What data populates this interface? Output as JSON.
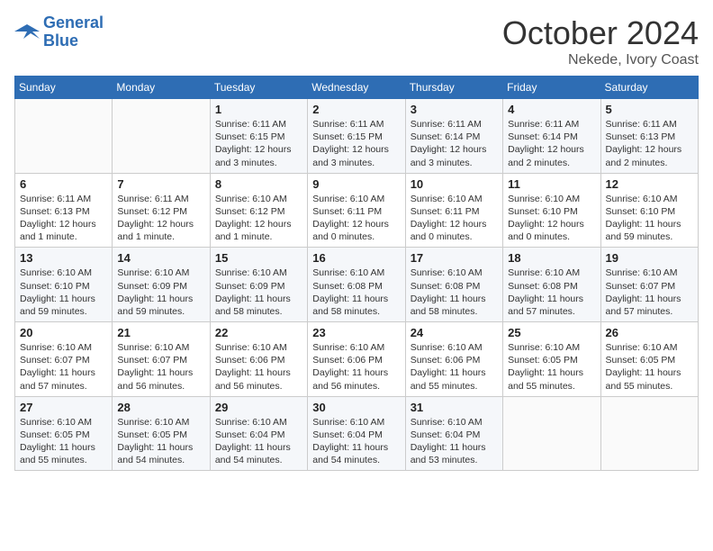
{
  "header": {
    "logo_line1": "General",
    "logo_line2": "Blue",
    "month": "October 2024",
    "location": "Nekede, Ivory Coast"
  },
  "weekdays": [
    "Sunday",
    "Monday",
    "Tuesday",
    "Wednesday",
    "Thursday",
    "Friday",
    "Saturday"
  ],
  "weeks": [
    [
      {
        "day": "",
        "info": ""
      },
      {
        "day": "",
        "info": ""
      },
      {
        "day": "1",
        "info": "Sunrise: 6:11 AM\nSunset: 6:15 PM\nDaylight: 12 hours\nand 3 minutes."
      },
      {
        "day": "2",
        "info": "Sunrise: 6:11 AM\nSunset: 6:15 PM\nDaylight: 12 hours\nand 3 minutes."
      },
      {
        "day": "3",
        "info": "Sunrise: 6:11 AM\nSunset: 6:14 PM\nDaylight: 12 hours\nand 3 minutes."
      },
      {
        "day": "4",
        "info": "Sunrise: 6:11 AM\nSunset: 6:14 PM\nDaylight: 12 hours\nand 2 minutes."
      },
      {
        "day": "5",
        "info": "Sunrise: 6:11 AM\nSunset: 6:13 PM\nDaylight: 12 hours\nand 2 minutes."
      }
    ],
    [
      {
        "day": "6",
        "info": "Sunrise: 6:11 AM\nSunset: 6:13 PM\nDaylight: 12 hours\nand 1 minute."
      },
      {
        "day": "7",
        "info": "Sunrise: 6:11 AM\nSunset: 6:12 PM\nDaylight: 12 hours\nand 1 minute."
      },
      {
        "day": "8",
        "info": "Sunrise: 6:10 AM\nSunset: 6:12 PM\nDaylight: 12 hours\nand 1 minute."
      },
      {
        "day": "9",
        "info": "Sunrise: 6:10 AM\nSunset: 6:11 PM\nDaylight: 12 hours\nand 0 minutes."
      },
      {
        "day": "10",
        "info": "Sunrise: 6:10 AM\nSunset: 6:11 PM\nDaylight: 12 hours\nand 0 minutes."
      },
      {
        "day": "11",
        "info": "Sunrise: 6:10 AM\nSunset: 6:10 PM\nDaylight: 12 hours\nand 0 minutes."
      },
      {
        "day": "12",
        "info": "Sunrise: 6:10 AM\nSunset: 6:10 PM\nDaylight: 11 hours\nand 59 minutes."
      }
    ],
    [
      {
        "day": "13",
        "info": "Sunrise: 6:10 AM\nSunset: 6:10 PM\nDaylight: 11 hours\nand 59 minutes."
      },
      {
        "day": "14",
        "info": "Sunrise: 6:10 AM\nSunset: 6:09 PM\nDaylight: 11 hours\nand 59 minutes."
      },
      {
        "day": "15",
        "info": "Sunrise: 6:10 AM\nSunset: 6:09 PM\nDaylight: 11 hours\nand 58 minutes."
      },
      {
        "day": "16",
        "info": "Sunrise: 6:10 AM\nSunset: 6:08 PM\nDaylight: 11 hours\nand 58 minutes."
      },
      {
        "day": "17",
        "info": "Sunrise: 6:10 AM\nSunset: 6:08 PM\nDaylight: 11 hours\nand 58 minutes."
      },
      {
        "day": "18",
        "info": "Sunrise: 6:10 AM\nSunset: 6:08 PM\nDaylight: 11 hours\nand 57 minutes."
      },
      {
        "day": "19",
        "info": "Sunrise: 6:10 AM\nSunset: 6:07 PM\nDaylight: 11 hours\nand 57 minutes."
      }
    ],
    [
      {
        "day": "20",
        "info": "Sunrise: 6:10 AM\nSunset: 6:07 PM\nDaylight: 11 hours\nand 57 minutes."
      },
      {
        "day": "21",
        "info": "Sunrise: 6:10 AM\nSunset: 6:07 PM\nDaylight: 11 hours\nand 56 minutes."
      },
      {
        "day": "22",
        "info": "Sunrise: 6:10 AM\nSunset: 6:06 PM\nDaylight: 11 hours\nand 56 minutes."
      },
      {
        "day": "23",
        "info": "Sunrise: 6:10 AM\nSunset: 6:06 PM\nDaylight: 11 hours\nand 56 minutes."
      },
      {
        "day": "24",
        "info": "Sunrise: 6:10 AM\nSunset: 6:06 PM\nDaylight: 11 hours\nand 55 minutes."
      },
      {
        "day": "25",
        "info": "Sunrise: 6:10 AM\nSunset: 6:05 PM\nDaylight: 11 hours\nand 55 minutes."
      },
      {
        "day": "26",
        "info": "Sunrise: 6:10 AM\nSunset: 6:05 PM\nDaylight: 11 hours\nand 55 minutes."
      }
    ],
    [
      {
        "day": "27",
        "info": "Sunrise: 6:10 AM\nSunset: 6:05 PM\nDaylight: 11 hours\nand 55 minutes."
      },
      {
        "day": "28",
        "info": "Sunrise: 6:10 AM\nSunset: 6:05 PM\nDaylight: 11 hours\nand 54 minutes."
      },
      {
        "day": "29",
        "info": "Sunrise: 6:10 AM\nSunset: 6:04 PM\nDaylight: 11 hours\nand 54 minutes."
      },
      {
        "day": "30",
        "info": "Sunrise: 6:10 AM\nSunset: 6:04 PM\nDaylight: 11 hours\nand 54 minutes."
      },
      {
        "day": "31",
        "info": "Sunrise: 6:10 AM\nSunset: 6:04 PM\nDaylight: 11 hours\nand 53 minutes."
      },
      {
        "day": "",
        "info": ""
      },
      {
        "day": "",
        "info": ""
      }
    ]
  ]
}
